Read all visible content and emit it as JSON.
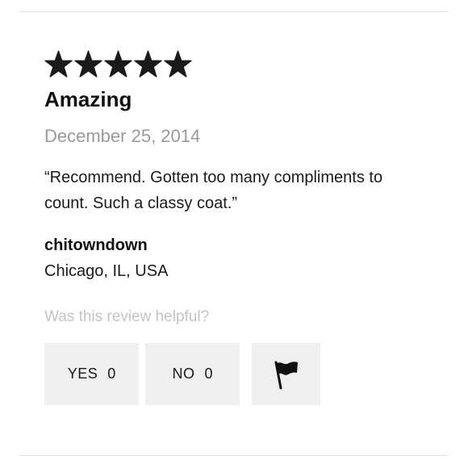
{
  "review": {
    "rating": 5,
    "rating_max": 5,
    "star_icon": "star-icon",
    "star_color": "#1a1a1a",
    "title": "Amazing",
    "date": "December 25, 2014",
    "body": "“Recommend. Gotten too many compliments to count. Such a classy coat.”",
    "author": {
      "name": "chitowndown",
      "location": "Chicago, IL, USA"
    }
  },
  "helpful": {
    "prompt": "Was this review helpful?",
    "yes_label": "YES",
    "yes_count": "0",
    "no_label": "NO",
    "no_count": "0",
    "flag_icon": "flag-icon"
  },
  "colors": {
    "button_bg": "#efefef",
    "muted_text": "#9a9a9a",
    "prompt_text": "#c4c4c4",
    "divider": "#e3e3e3"
  }
}
